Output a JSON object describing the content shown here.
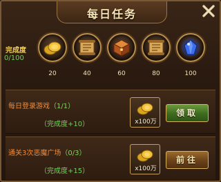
{
  "window": {
    "title": "每日任务"
  },
  "progress": {
    "label": "完成度",
    "value": "0/100",
    "milestones": [
      {
        "points": "20",
        "icon": "gold-coins-icon"
      },
      {
        "points": "40",
        "icon": "treasure-scroll-icon"
      },
      {
        "points": "60",
        "icon": "treasure-chest-icon"
      },
      {
        "points": "80",
        "icon": "treasure-scroll-icon"
      },
      {
        "points": "100",
        "icon": "blue-gem-icon"
      }
    ]
  },
  "tasks": [
    {
      "name": "每日登录游戏",
      "progress": "（1/1）",
      "completion": "（完成度+10）",
      "reward_icon": "gold-coins-icon",
      "reward_qty": "x100万",
      "button": "领取",
      "button_color": "#4a7a26"
    },
    {
      "name": "通关3次恶魔广场",
      "progress": "（0/3）",
      "completion": "（完成度+15）",
      "reward_icon": "gold-coins-icon",
      "reward_qty": "x100万",
      "button": "前往",
      "button_color": "#7a4a1e"
    }
  ],
  "colors": {
    "accent_gold": "#f2cf5a",
    "progress_green": "#6fd25a",
    "task_orange": "#f08a3a",
    "frame_border": "#7a5a34"
  }
}
